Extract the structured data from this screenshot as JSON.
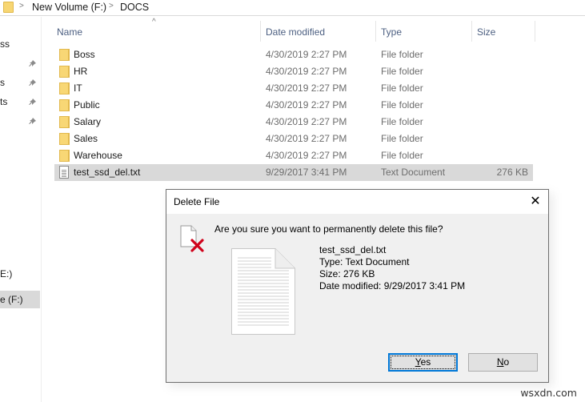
{
  "address_bar": {
    "icon": "folder-icon",
    "breadcrumbs": [
      "New Volume (F:)",
      "DOCS"
    ],
    "separator": ">"
  },
  "nav_pane": {
    "items": [
      {
        "label": "ss",
        "pinned": false
      },
      {
        "label": "",
        "pinned": true
      },
      {
        "label": "s",
        "pinned": true
      },
      {
        "label": "ts",
        "pinned": true
      },
      {
        "label": "",
        "pinned": true
      },
      {
        "label": "E:)",
        "pinned": false
      },
      {
        "label": "e (F:)",
        "pinned": false,
        "selected": true
      }
    ],
    "pin_icon": "pin-icon"
  },
  "file_list": {
    "sort_indicator": "^",
    "columns": [
      "Name",
      "Date modified",
      "Type",
      "Size"
    ],
    "rows": [
      {
        "name": "Boss",
        "date": "4/30/2019 2:27 PM",
        "type": "File folder",
        "size": "",
        "icon": "folder-icon"
      },
      {
        "name": "HR",
        "date": "4/30/2019 2:27 PM",
        "type": "File folder",
        "size": "",
        "icon": "folder-icon"
      },
      {
        "name": "IT",
        "date": "4/30/2019 2:27 PM",
        "type": "File folder",
        "size": "",
        "icon": "folder-icon"
      },
      {
        "name": "Public",
        "date": "4/30/2019 2:27 PM",
        "type": "File folder",
        "size": "",
        "icon": "folder-icon"
      },
      {
        "name": "Salary",
        "date": "4/30/2019 2:27 PM",
        "type": "File folder",
        "size": "",
        "icon": "folder-icon"
      },
      {
        "name": "Sales",
        "date": "4/30/2019 2:27 PM",
        "type": "File folder",
        "size": "",
        "icon": "folder-icon"
      },
      {
        "name": "Warehouse",
        "date": "4/30/2019 2:27 PM",
        "type": "File folder",
        "size": "",
        "icon": "folder-icon"
      },
      {
        "name": "test_ssd_del.txt",
        "date": "9/29/2017 3:41 PM",
        "type": "Text Document",
        "size": "276 KB",
        "icon": "text-file-icon",
        "selected": true
      }
    ]
  },
  "dialog": {
    "title": "Delete File",
    "close_glyph": "✕",
    "question": "Are you sure you want to permanently delete this file?",
    "file": {
      "name": "test_ssd_del.txt",
      "type_line": "Type: Text Document",
      "size_line": "Size: 276 KB",
      "date_line": "Date modified: 9/29/2017 3:41 PM"
    },
    "buttons": {
      "yes": {
        "mnemonic": "Y",
        "rest": "es"
      },
      "no": {
        "mnemonic": "N",
        "rest": "o"
      }
    },
    "accent_color": "#0078d7",
    "delete_mark_color": "#d0021b"
  },
  "watermark": "wsxdn.com"
}
